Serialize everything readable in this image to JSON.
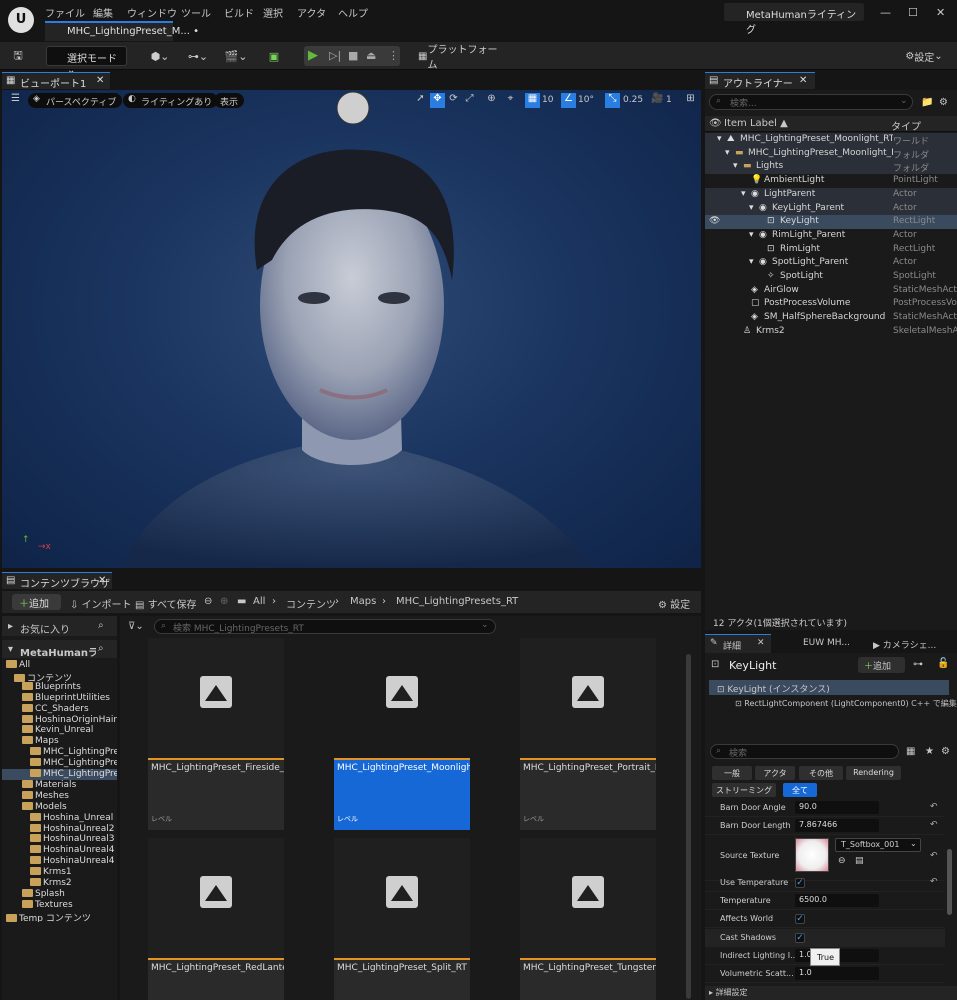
{
  "menu": [
    "ファイル",
    "編集",
    "ウィンドウ",
    "ツール",
    "ビルド",
    "選択",
    "アクタ",
    "ヘルプ"
  ],
  "document_tab": "MHC_LightingPreset_M...",
  "project_name": "MetaHumanライティング",
  "toolbar": {
    "select_mode": "選択モード",
    "platforms": "プラットフォーム",
    "settings": "設定"
  },
  "viewport": {
    "tab": "ビューポート1",
    "perspective": "パースペクティブ",
    "lighting": "ライティングあり",
    "show": "表示",
    "grid_snap": "10",
    "rotation_snap": "10°",
    "scale_snap": "0.25",
    "camera_speed": "1"
  },
  "outliner": {
    "tab": "アウトライナー",
    "search_placeholder": "検索...",
    "col_label": "Item Label",
    "col_type": "タイプ",
    "rows": [
      {
        "name": "MHC_LightingPreset_Moonlight_RT",
        "type": "ワールド",
        "icon": "world-icon",
        "hl": true
      },
      {
        "name": "MHC_LightingPreset_Moonlight_R",
        "type": "フォルダ",
        "icon": "folder-icon",
        "hl": true
      },
      {
        "name": "Lights",
        "type": "フォルダ",
        "icon": "folder-icon",
        "hl": true
      },
      {
        "name": "AmbientLight",
        "type": "PointLight",
        "icon": "point-light-icon",
        "hl": false
      },
      {
        "name": "LightParent",
        "type": "Actor",
        "icon": "actor-icon",
        "hl": true
      },
      {
        "name": "KeyLight_Parent",
        "type": "Actor",
        "icon": "actor-icon",
        "hl": true
      },
      {
        "name": "KeyLight",
        "type": "RectLight",
        "icon": "rect-light-icon",
        "hl": false,
        "sel": true
      },
      {
        "name": "RimLight_Parent",
        "type": "Actor",
        "icon": "actor-icon",
        "hl": false
      },
      {
        "name": "RimLight",
        "type": "RectLight",
        "icon": "rect-light-icon",
        "hl": false
      },
      {
        "name": "SpotLight_Parent",
        "type": "Actor",
        "icon": "actor-icon",
        "hl": false
      },
      {
        "name": "SpotLight",
        "type": "SpotLight",
        "icon": "spot-light-icon",
        "hl": false
      },
      {
        "name": "AirGlow",
        "type": "StaticMeshActor",
        "icon": "mesh-icon",
        "hl": false
      },
      {
        "name": "PostProcessVolume",
        "type": "PostProcessVolume",
        "icon": "volume-icon",
        "hl": false
      },
      {
        "name": "SM_HalfSphereBackground",
        "type": "StaticMeshActor",
        "icon": "mesh-icon",
        "hl": false
      },
      {
        "name": "Krms2",
        "type": "SkeletalMeshActor",
        "icon": "skeletal-icon",
        "hl": false
      }
    ],
    "status": "12 アクタ(1個選択されています)"
  },
  "content_browser": {
    "tab": "コンテンツブラウザ",
    "add": "追加",
    "import": "インポート",
    "save_all": "すべて保存",
    "breadcrumb": [
      "All",
      "コンテンツ",
      "Maps",
      "MHC_LightingPresets_RT"
    ],
    "settings": "設定",
    "favorites": "お気に入り",
    "root": "MetaHumanライテ",
    "search_placeholder": "検索 MHC_LightingPresets_RT",
    "tree": [
      "All",
      "コンテンツ",
      "Blueprints",
      "BlueprintUtilities",
      "CC_Shaders",
      "HoshinaOriginHair",
      "Kevin_Unreal",
      "Maps",
      "MHC_LightingPre",
      "MHC_LightingPre",
      "MHC_LightingPre",
      "Materials",
      "Meshes",
      "Models",
      "Hoshina_Unreal",
      "HoshinaUnreal2",
      "HoshinaUnreal3",
      "HoshinaUnreal4",
      "HoshinaUnreal4",
      "Krms1",
      "Krms2",
      "Splash",
      "Textures",
      "Temp コンテンツ"
    ],
    "assets": [
      {
        "name": "MHC_LightingPreset_Fireside_RT",
        "type": "レベル"
      },
      {
        "name": "MHC_LightingPreset_Moonlight_RT",
        "type": "レベル",
        "sel": true
      },
      {
        "name": "MHC_LightingPreset_Portrait_RT",
        "type": "レベル"
      },
      {
        "name": "MHC_LightingPreset_RedLantern_RT",
        "type": "レベル"
      },
      {
        "name": "MHC_LightingPreset_Split_RT",
        "type": "レベル"
      },
      {
        "name": "MHC_LightingPreset_Tungsten_RT",
        "type": "レベル"
      }
    ]
  },
  "details": {
    "tabs": [
      "詳細",
      "EUW MH...",
      "カメラシェ..."
    ],
    "title": "KeyLight",
    "add": "追加",
    "instance": "KeyLight (インスタンス)",
    "component": "RectLightComponent (LightComponent0)",
    "cpp_link": "C++ で編集",
    "search_placeholder": "検索",
    "filters": [
      "一般",
      "アクタ",
      "その他",
      "Rendering",
      "ストリーミング",
      "全て"
    ],
    "props": [
      {
        "label": "Barn Door Angle",
        "value": "90.0"
      },
      {
        "label": "Barn Door Length",
        "value": "7.867466"
      },
      {
        "label": "Source Texture",
        "value": "T_Softbox_001"
      },
      {
        "label": "Use Temperature",
        "value": "true"
      },
      {
        "label": "Temperature",
        "value": "6500.0"
      },
      {
        "label": "Affects World",
        "value": "true"
      },
      {
        "label": "Cast Shadows",
        "value": "true"
      },
      {
        "label": "Indirect Lighting I...",
        "value": "1.0"
      },
      {
        "label": "Volumetric Scatt...",
        "value": "1.0"
      }
    ],
    "tooltip": "True",
    "section": "詳細設定"
  },
  "colors": {
    "accent": "#2a7de1",
    "selection": "#1668d6",
    "folder": "#c8a25a",
    "play": "#5fbd3a"
  }
}
